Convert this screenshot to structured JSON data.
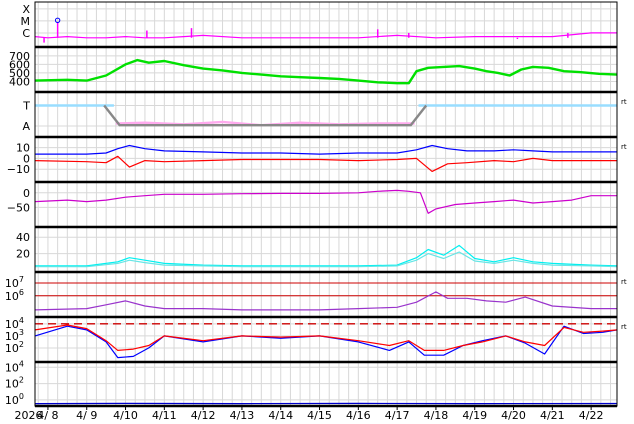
{
  "chart_data": {
    "type": "line",
    "x_range": [
      "2026-04-07T16:00",
      "2026-04-22T16:00"
    ],
    "x_ticks": [
      {
        "label": "2026",
        "x": "2026-04-07T12:00"
      },
      {
        "label": "4/ 8",
        "x": "2026-04-08"
      },
      {
        "label": "4/ 9",
        "x": "2026-04-09"
      },
      {
        "label": "4/10",
        "x": "2026-04-10"
      },
      {
        "label": "4/11",
        "x": "2026-04-11"
      },
      {
        "label": "4/12",
        "x": "2026-04-12"
      },
      {
        "label": "4/13",
        "x": "2026-04-13"
      },
      {
        "label": "4/14",
        "x": "2026-04-14"
      },
      {
        "label": "4/15",
        "x": "2026-04-15"
      },
      {
        "label": "4/16",
        "x": "2026-04-16"
      },
      {
        "label": "4/17",
        "x": "2026-04-17"
      },
      {
        "label": "4/18",
        "x": "2026-04-18"
      },
      {
        "label": "4/19",
        "x": "2026-04-19"
      },
      {
        "label": "4/20",
        "x": "2026-04-20"
      },
      {
        "label": "4/21",
        "x": "2026-04-21"
      },
      {
        "label": "4/22",
        "x": "2026-04-22"
      }
    ],
    "grid": true,
    "panels": [
      {
        "id": "xray",
        "scale": "categorical",
        "ylim": [
          0,
          3.4
        ],
        "ticks": [
          {
            "v": 3,
            "label": "X"
          },
          {
            "v": 2,
            "label": "M"
          },
          {
            "v": 1,
            "label": "C"
          }
        ],
        "right_mark": "",
        "series": [
          {
            "color": "#ff00ff",
            "t": [
              7.67,
              8.0,
              8.5,
              9.0,
              9.5,
              10.0,
              10.5,
              11.0,
              11.5,
              12.0,
              13.0,
              14.0,
              15.0,
              16.0,
              17.0,
              18.0,
              19.0,
              20.0,
              21.0,
              22.0,
              22.67
            ],
            "v": [
              0.7,
              0.6,
              0.7,
              0.6,
              0.6,
              0.7,
              0.6,
              0.6,
              0.7,
              0.8,
              0.6,
              0.6,
              0.6,
              0.6,
              0.8,
              0.6,
              0.7,
              0.7,
              0.7,
              1.0,
              1.0
            ]
          }
        ],
        "spikes": [
          {
            "t": 7.9,
            "v": 0.2
          },
          {
            "t": 8.25,
            "v": 1.9
          },
          {
            "t": 10.55,
            "v": 1.2
          },
          {
            "t": 11.7,
            "v": 1.4
          },
          {
            "t": 16.5,
            "v": 1.3
          },
          {
            "t": 17.3,
            "v": 1.0
          },
          {
            "t": 20.1,
            "v": 0.5
          },
          {
            "t": 21.4,
            "v": 1.0
          }
        ],
        "marker": {
          "t": 8.25,
          "v": 2.05,
          "color": "#0000ff"
        }
      },
      {
        "id": "wind_speed",
        "scale": "linear",
        "ylim": [
          300,
          780
        ],
        "ticks": [
          {
            "v": 400,
            "label": "400"
          },
          {
            "v": 500,
            "label": "500"
          },
          {
            "v": 600,
            "label": "600"
          },
          {
            "v": 700,
            "label": "700"
          }
        ],
        "right_mark": "",
        "series": [
          {
            "color": "#00e000",
            "t": [
              7.67,
              8.5,
              9.0,
              9.5,
              10.0,
              10.3,
              10.6,
              11.0,
              11.5,
              12.0,
              12.5,
              13.0,
              13.5,
              14.0,
              14.5,
              15.0,
              15.5,
              16.0,
              16.5,
              17.0,
              17.3,
              17.5,
              17.8,
              18.2,
              18.6,
              19.0,
              19.3,
              19.6,
              19.9,
              20.2,
              20.5,
              20.9,
              21.3,
              21.7,
              22.2,
              22.67
            ],
            "v": [
              410,
              420,
              410,
              470,
              600,
              650,
              620,
              640,
              590,
              550,
              530,
              500,
              480,
              460,
              450,
              440,
              430,
              410,
              390,
              380,
              380,
              520,
              560,
              570,
              580,
              550,
              520,
              500,
              470,
              540,
              570,
              560,
              520,
              510,
              490,
              480
            ]
          }
        ]
      },
      {
        "id": "direction",
        "scale": "categorical",
        "ylim": [
          0,
          5
        ],
        "ticks": [
          {
            "v": 3.6,
            "label": "T"
          },
          {
            "v": 1.1,
            "label": "A"
          }
        ],
        "right_mark": "rt",
        "series": [
          {
            "color": "#99ddff",
            "t": [
              7.67,
              9.7,
              9.7,
              17.55,
              17.55,
              22.67
            ],
            "v": [
              3.6,
              3.6,
              null,
              null,
              3.6,
              3.6
            ]
          },
          {
            "color": "#ffaaee",
            "t": [
              9.75,
              10.5,
              11.5,
              12.5,
              13.5,
              14.5,
              15.5,
              16.5,
              17.45
            ],
            "v": [
              1.4,
              1.5,
              1.3,
              1.6,
              1.2,
              1.5,
              1.3,
              1.4,
              1.4
            ]
          },
          {
            "color": "#888888",
            "t": [
              9.45,
              9.85,
              17.35,
              17.75
            ],
            "v": [
              3.6,
              1.2,
              1.2,
              3.6
            ]
          }
        ]
      },
      {
        "id": "bz",
        "scale": "linear",
        "ylim": [
          -20,
          18
        ],
        "ticks": [
          {
            "v": 10,
            "label": "10"
          },
          {
            "v": 0,
            "label": "0"
          },
          {
            "v": -10,
            "label": "−10"
          }
        ],
        "right_mark": "rt",
        "series": [
          {
            "color": "#0000ff",
            "t": [
              7.67,
              9.0,
              9.5,
              9.8,
              10.1,
              10.5,
              11.0,
              12.0,
              13.0,
              14.0,
              15.0,
              16.0,
              17.0,
              17.5,
              17.9,
              18.3,
              18.8,
              19.5,
              20.0,
              20.5,
              21.0,
              22.0,
              22.67
            ],
            "v": [
              4,
              4,
              5,
              9,
              12,
              9,
              7,
              6,
              5,
              5,
              4,
              5,
              5,
              8,
              12,
              9,
              7,
              7,
              8,
              7,
              6,
              6,
              6
            ]
          },
          {
            "color": "#ff0000",
            "t": [
              7.67,
              9.0,
              9.5,
              9.8,
              10.1,
              10.5,
              11.0,
              12.0,
              13.0,
              14.0,
              15.0,
              16.0,
              17.0,
              17.5,
              17.9,
              18.3,
              18.8,
              19.5,
              20.0,
              20.5,
              21.0,
              22.0,
              22.67
            ],
            "v": [
              -2,
              -3,
              -4,
              2,
              -8,
              -2,
              -3,
              -2,
              -1,
              -1,
              -1,
              -2,
              -1,
              0,
              -12,
              -5,
              -4,
              -2,
              -3,
              0,
              -2,
              -2,
              -2
            ]
          }
        ]
      },
      {
        "id": "dst",
        "scale": "linear",
        "ylim": [
          -110,
          30
        ],
        "ticks": [
          {
            "v": 0,
            "label": "0"
          },
          {
            "v": -50,
            "label": "−50"
          }
        ],
        "right_mark": "",
        "series": [
          {
            "color": "#cc00cc",
            "t": [
              7.67,
              8.5,
              9.0,
              9.5,
              10.0,
              10.5,
              11.0,
              12.0,
              13.0,
              14.0,
              15.0,
              16.0,
              16.5,
              17.0,
              17.3,
              17.6,
              17.8,
              18.0,
              18.5,
              19.0,
              19.5,
              20.0,
              20.5,
              21.0,
              21.5,
              22.0,
              22.67
            ],
            "v": [
              -30,
              -25,
              -30,
              -25,
              -15,
              -10,
              -5,
              -5,
              -3,
              -2,
              -2,
              0,
              5,
              8,
              5,
              0,
              -70,
              -55,
              -40,
              -35,
              -30,
              -25,
              -35,
              -30,
              -25,
              -10,
              -10
            ]
          }
        ]
      },
      {
        "id": "kp",
        "scale": "linear",
        "ylim": [
          0,
          50
        ],
        "ticks": [
          {
            "v": 20,
            "label": "20"
          },
          {
            "v": 40,
            "label": "40"
          }
        ],
        "right_mark": "",
        "series": [
          {
            "color": "#00f0f0",
            "t": [
              7.67,
              9.0,
              9.8,
              10.1,
              10.5,
              11.0,
              12.0,
              13.0,
              14.0,
              15.0,
              16.0,
              17.0,
              17.5,
              17.8,
              18.2,
              18.6,
              19.0,
              19.5,
              20.0,
              20.5,
              21.0,
              22.0,
              22.67
            ],
            "v": [
              5,
              5,
              10,
              15,
              12,
              8,
              6,
              5,
              5,
              5,
              5,
              6,
              15,
              25,
              18,
              30,
              14,
              10,
              15,
              10,
              8,
              6,
              5
            ]
          },
          {
            "color": "#66e6e6",
            "t": [
              7.67,
              9.0,
              9.8,
              10.1,
              10.5,
              11.0,
              12.0,
              13.0,
              14.0,
              15.0,
              16.0,
              17.0,
              17.5,
              17.8,
              18.2,
              18.6,
              19.0,
              19.5,
              20.0,
              20.5,
              21.0,
              22.0,
              22.67
            ],
            "v": [
              4,
              4,
              8,
              12,
              9,
              6,
              5,
              4,
              4,
              4,
              4,
              5,
              12,
              20,
              14,
              22,
              11,
              8,
              12,
              8,
              6,
              5,
              4
            ]
          }
        ]
      },
      {
        "id": "electron_flux",
        "scale": "log",
        "ylim": [
          4.5,
          7.7
        ],
        "ticks": [
          {
            "v": 6,
            "label": "10",
            "exp": "6"
          },
          {
            "v": 7,
            "label": "10",
            "exp": "7"
          }
        ],
        "right_mark": "rt",
        "hlines": [
          {
            "v": 7,
            "color": "#cc0000"
          },
          {
            "v": 6,
            "color": "#cc0000"
          }
        ],
        "series": [
          {
            "color": "#9933cc",
            "t": [
              7.67,
              9.0,
              9.5,
              10.0,
              10.5,
              11.0,
              12.0,
              13.0,
              14.0,
              15.0,
              16.0,
              17.0,
              17.5,
              18.0,
              18.3,
              18.8,
              19.3,
              19.8,
              20.3,
              21.0,
              22.0,
              22.67
            ],
            "v": [
              4.9,
              5.0,
              5.3,
              5.6,
              5.2,
              5.0,
              5.0,
              4.9,
              4.9,
              4.9,
              5.0,
              5.1,
              5.5,
              6.3,
              5.8,
              5.8,
              5.6,
              5.5,
              5.9,
              5.2,
              5.0,
              5.0
            ]
          }
        ]
      },
      {
        "id": "proton_flux",
        "scale": "log",
        "ylim": [
          1,
          4.4
        ],
        "ticks": [
          {
            "v": 2,
            "label": "10",
            "exp": "2"
          },
          {
            "v": 3,
            "label": "10",
            "exp": "3"
          },
          {
            "v": 4,
            "label": "10",
            "exp": "4"
          }
        ],
        "right_mark": "rt",
        "hlines": [
          {
            "v": 4,
            "color": "#cc0000",
            "dashed": true
          }
        ],
        "series": [
          {
            "color": "#0000ff",
            "t": [
              7.67,
              8.5,
              9.0,
              9.5,
              9.8,
              10.2,
              10.6,
              11.0,
              12.0,
              13.0,
              14.0,
              15.0,
              16.0,
              16.8,
              17.3,
              17.7,
              18.2,
              18.7,
              19.2,
              19.8,
              20.3,
              20.8,
              21.3,
              21.8,
              22.3,
              22.67
            ],
            "v": [
              3.0,
              3.8,
              3.5,
              2.5,
              1.2,
              1.3,
              2.0,
              3.0,
              2.5,
              3.0,
              2.8,
              3.0,
              2.5,
              1.8,
              2.5,
              1.4,
              1.4,
              2.2,
              2.6,
              3.0,
              2.4,
              1.5,
              3.8,
              3.2,
              3.3,
              3.5
            ]
          },
          {
            "color": "#ff0000",
            "t": [
              7.67,
              8.5,
              9.0,
              9.5,
              9.8,
              10.2,
              10.6,
              11.0,
              12.0,
              13.0,
              14.0,
              15.0,
              16.0,
              16.8,
              17.3,
              17.7,
              18.2,
              18.7,
              19.2,
              19.8,
              20.3,
              20.8,
              21.3,
              21.8,
              22.3,
              22.67
            ],
            "v": [
              3.5,
              3.9,
              3.6,
              2.6,
              1.8,
              1.9,
              2.2,
              3.0,
              2.6,
              3.0,
              2.9,
              3.0,
              2.6,
              2.2,
              2.6,
              1.8,
              1.8,
              2.2,
              2.5,
              3.0,
              2.5,
              2.2,
              3.7,
              3.3,
              3.4,
              3.5
            ]
          }
        ]
      },
      {
        "id": "bottom",
        "scale": "log",
        "ylim": [
          -0.5,
          4.4
        ],
        "ticks": [
          {
            "v": 0,
            "label": "10",
            "exp": "0"
          },
          {
            "v": 2,
            "label": "10",
            "exp": "2"
          },
          {
            "v": 4,
            "label": "10",
            "exp": "4"
          }
        ],
        "right_mark": "",
        "series": [
          {
            "color": "#0000cc",
            "t": [
              7.67,
              10.0,
              13.0,
              16.0,
              19.0,
              22.67
            ],
            "v": [
              -0.45,
              -0.43,
              -0.45,
              -0.43,
              -0.45,
              -0.44
            ]
          }
        ]
      }
    ]
  }
}
